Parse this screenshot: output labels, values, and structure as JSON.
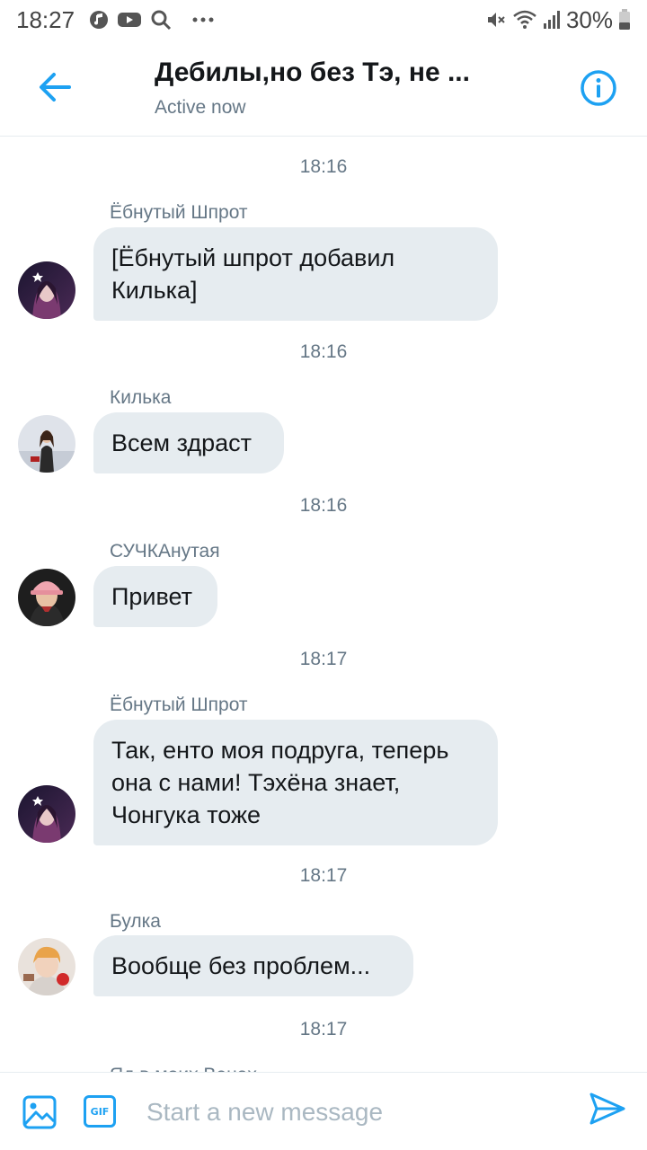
{
  "status_bar": {
    "time": "18:27",
    "battery": "30%",
    "icons": [
      "music-icon",
      "youtube-icon",
      "search-icon",
      "more-icon",
      "mute-icon",
      "wifi-icon",
      "signal-icon",
      "battery-icon"
    ]
  },
  "header": {
    "title": "Дебилы,но без Тэ, не ...",
    "status": "Active now"
  },
  "messages": [
    {
      "timestamp": "18:16",
      "sender": "Ёбнутый Шпрот",
      "text_lines": [
        "[Ёбнутый шпрот добавил",
        "Килька]"
      ],
      "avatar": "avatar-shprot"
    },
    {
      "timestamp": "18:16",
      "sender": "Килька",
      "text_lines": [
        "Всем здраст"
      ],
      "avatar": "avatar-kilka"
    },
    {
      "timestamp": "18:16",
      "sender": "СУЧКАнутая",
      "text_lines": [
        "Привет"
      ],
      "avatar": "avatar-suchka"
    },
    {
      "timestamp": "18:17",
      "sender": "Ёбнутый Шпрот",
      "text_lines": [
        "Так, енто моя подруга, теперь",
        "она с нами! Тэхёна знает,",
        "Чонгука тоже"
      ],
      "avatar": "avatar-shprot"
    },
    {
      "timestamp": "18:17",
      "sender": "Булка",
      "text_lines": [
        "Вообще без проблем..."
      ],
      "avatar": "avatar-bulka"
    }
  ],
  "last_timestamp": "18:17",
  "partial_sender": "Яд в моих Венах",
  "composer": {
    "placeholder": "Start a new message",
    "gif_label": "GIF"
  },
  "colors": {
    "accent": "#1da1f2",
    "bubble": "#e6ecf0",
    "secondary_text": "#657786"
  }
}
